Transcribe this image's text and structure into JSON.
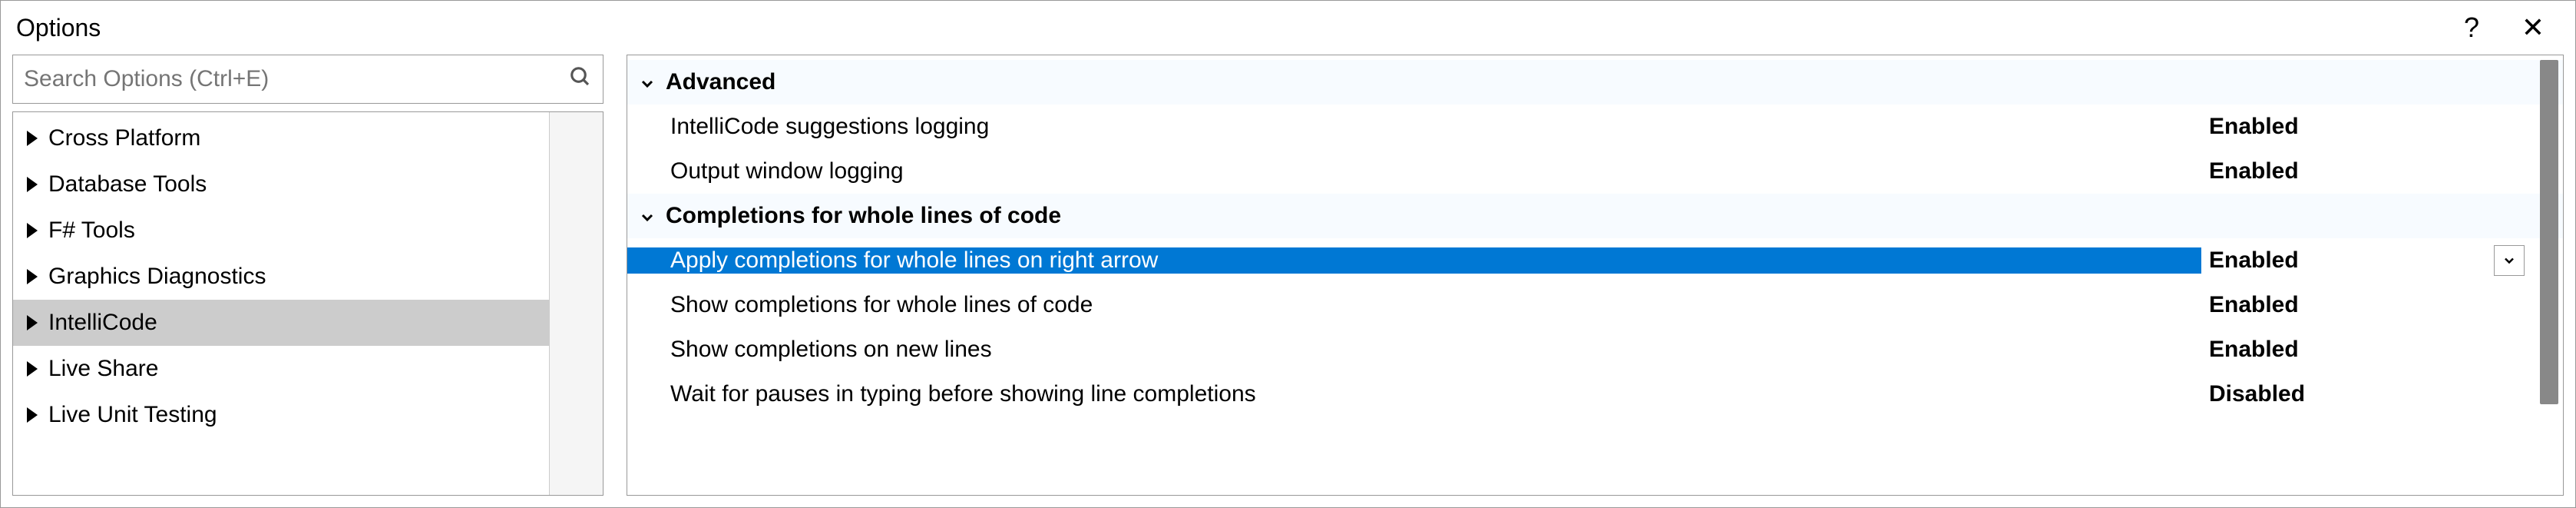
{
  "window": {
    "title": "Options",
    "help": "?",
    "close": "✕"
  },
  "search": {
    "placeholder": "Search Options (Ctrl+E)"
  },
  "tree": {
    "items": [
      {
        "label": "Cross Platform",
        "selected": false
      },
      {
        "label": "Database Tools",
        "selected": false
      },
      {
        "label": "F# Tools",
        "selected": false
      },
      {
        "label": "Graphics Diagnostics",
        "selected": false
      },
      {
        "label": "IntelliCode",
        "selected": true
      },
      {
        "label": "Live Share",
        "selected": false
      },
      {
        "label": "Live Unit Testing",
        "selected": false
      }
    ]
  },
  "grid": {
    "categories": [
      {
        "name": "Advanced",
        "props": [
          {
            "label": "IntelliCode suggestions logging",
            "value": "Enabled",
            "selected": false
          },
          {
            "label": "Output window logging",
            "value": "Enabled",
            "selected": false
          }
        ]
      },
      {
        "name": "Completions for whole lines of code",
        "props": [
          {
            "label": "Apply completions for whole lines on right arrow",
            "value": "Enabled",
            "selected": true
          },
          {
            "label": "Show completions for whole lines of code",
            "value": "Enabled",
            "selected": false
          },
          {
            "label": "Show completions on new lines",
            "value": "Enabled",
            "selected": false
          },
          {
            "label": "Wait for pauses in typing before showing line completions",
            "value": "Disabled",
            "selected": false
          }
        ]
      }
    ]
  }
}
